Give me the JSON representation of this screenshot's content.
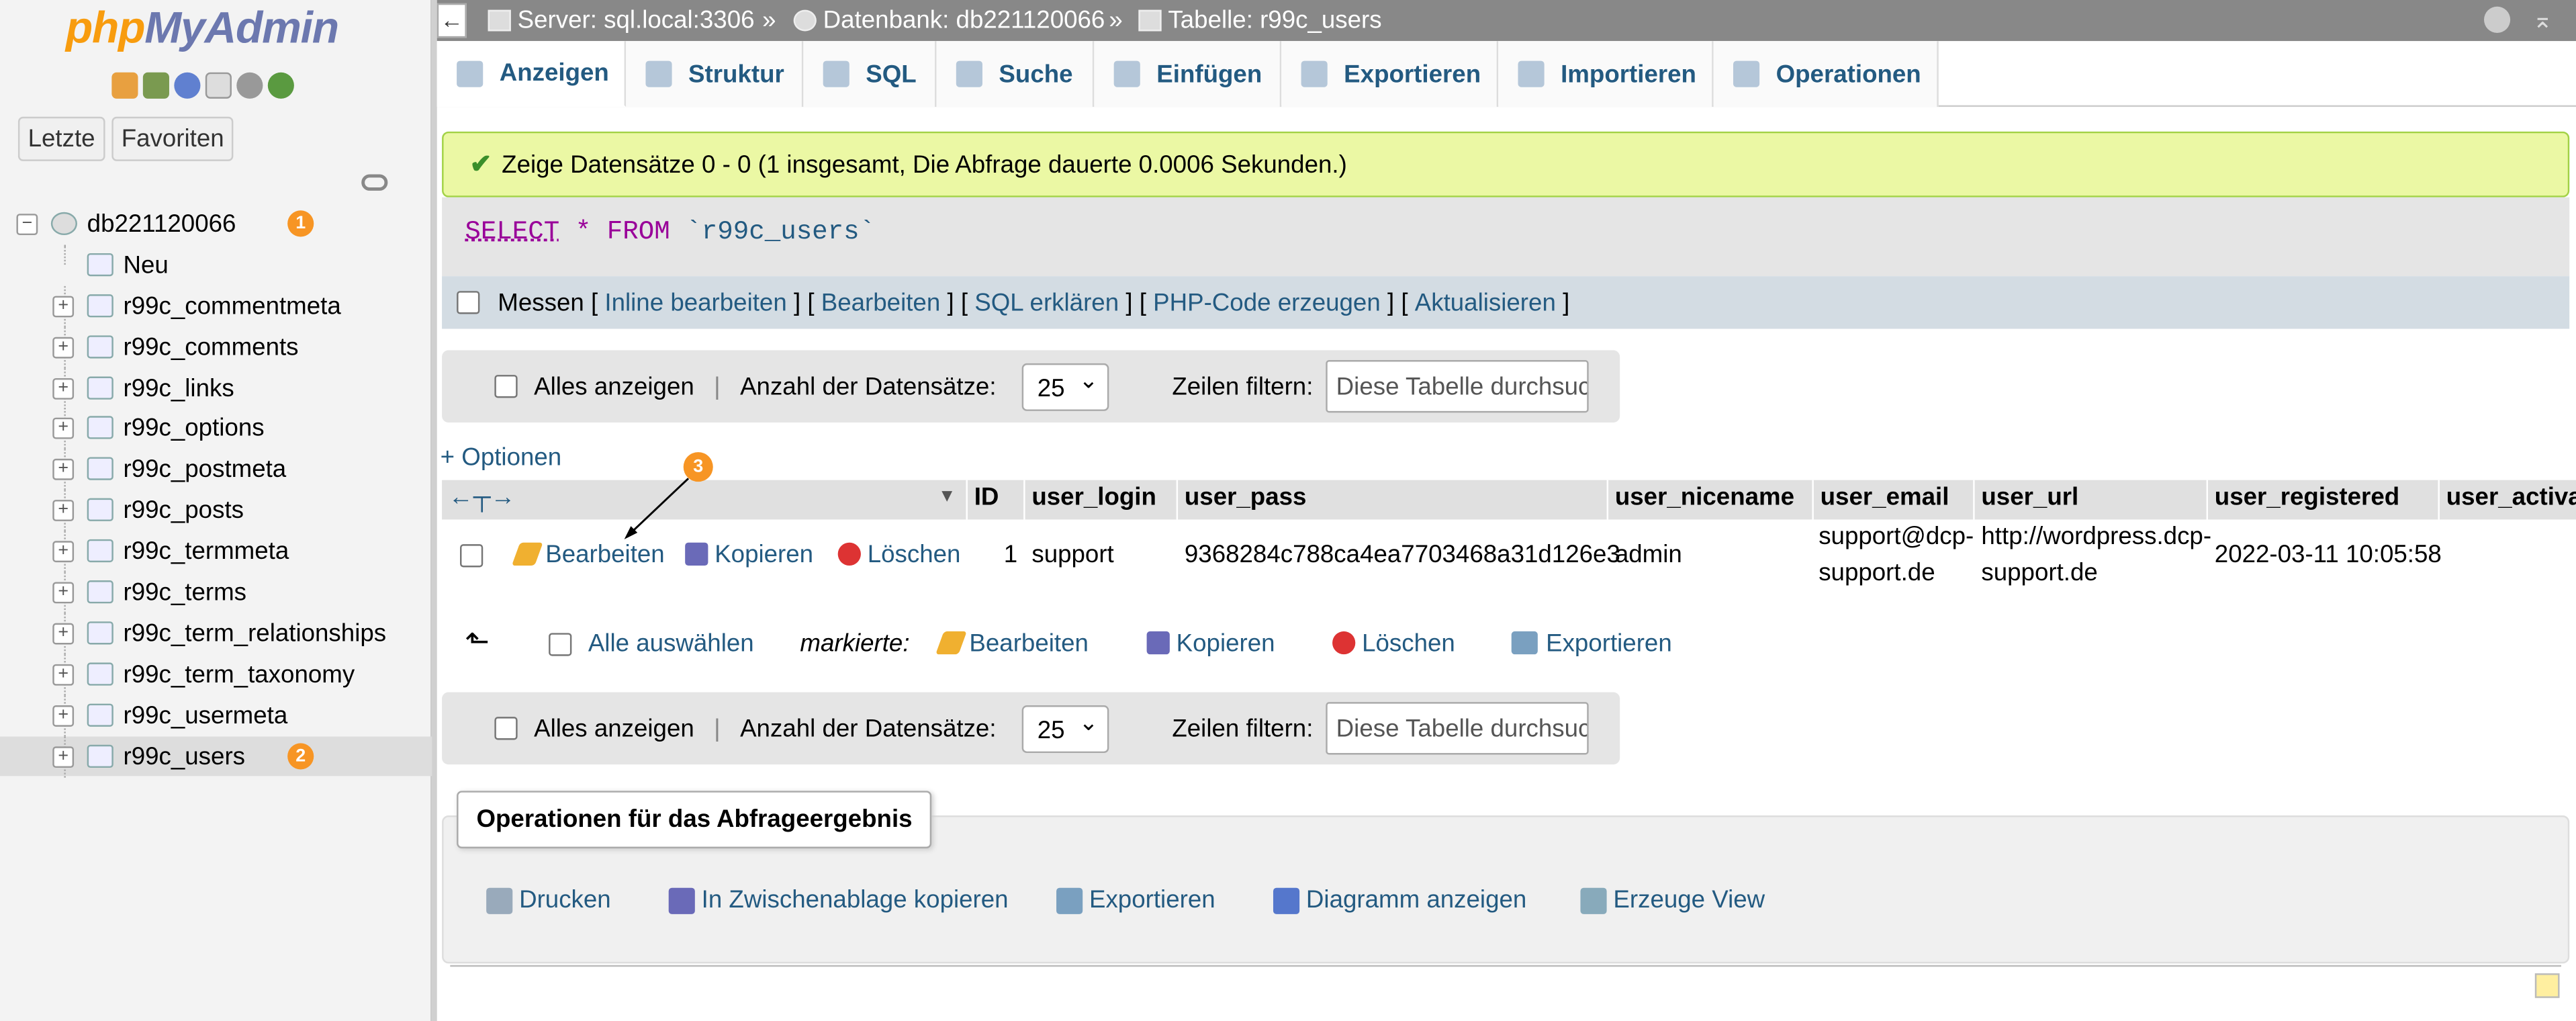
{
  "logo": {
    "a": "php",
    "b": "MyAdmin"
  },
  "sidebar": {
    "recent": "Letzte",
    "favorites": "Favoriten",
    "db": "db221120066",
    "new_label": "Neu",
    "tables": [
      "r99c_commentmeta",
      "r99c_comments",
      "r99c_links",
      "r99c_options",
      "r99c_postmeta",
      "r99c_posts",
      "r99c_termmeta",
      "r99c_terms",
      "r99c_term_relationships",
      "r99c_term_taxonomy",
      "r99c_usermeta",
      "r99c_users"
    ],
    "badge1": "1",
    "badge2": "2"
  },
  "breadcrumb": {
    "server": "Server: sql.local:3306",
    "database": "Datenbank: db221120066",
    "table": "Tabelle: r99c_users",
    "sep": "»"
  },
  "tabs": [
    "Anzeigen",
    "Struktur",
    "SQL",
    "Suche",
    "Einfügen",
    "Exportieren",
    "Importieren",
    "Operationen"
  ],
  "message": "Zeige Datensätze 0 - 0 (1 insgesamt, Die Abfrage dauerte 0.0006 Sekunden.)",
  "sql": {
    "select": "SELECT",
    "star": "*",
    "from": "FROM",
    "table": "`r99c_users`"
  },
  "sql_actions": {
    "profile": "Messen",
    "inline": "Inline bearbeiten",
    "edit": "Bearbeiten",
    "explain": "SQL erklären",
    "php": "PHP-Code erzeugen",
    "refresh": "Aktualisieren"
  },
  "nav": {
    "show_all": "Alles anzeigen",
    "rows_label": "Anzahl der Datensätze:",
    "rows": "25",
    "filter_label": "Zeilen filtern:",
    "filter_placeholder": "Diese Tabelle durchsuchen"
  },
  "options_link": "+ Optionen",
  "grid": {
    "headers": [
      "ID",
      "user_login",
      "user_pass",
      "user_nicename",
      "user_email",
      "user_url",
      "user_registered",
      "user_activa"
    ],
    "row": {
      "edit": "Bearbeiten",
      "copy": "Kopieren",
      "delete": "Löschen",
      "id": "1",
      "login": "support",
      "pass": "9368284c788ca4ea7703468a31d126e3",
      "nicename": "admin",
      "email1": "support@dcp-",
      "email2": "support.de",
      "url1": "http://wordpress.dcp-",
      "url2": "support.de",
      "registered": "2022-03-11 10:05:58"
    }
  },
  "bulk": {
    "select_all": "Alle auswählen",
    "with_selected": "markierte:",
    "edit": "Bearbeiten",
    "copy": "Kopieren",
    "delete": "Löschen",
    "export": "Exportieren"
  },
  "callout": "3",
  "ops": {
    "legend": "Operationen für das Abfrageergebnis",
    "print": "Drucken",
    "clipboard": "In Zwischenablage kopieren",
    "export": "Exportieren",
    "chart": "Diagramm anzeigen",
    "view": "Erzeuge View"
  }
}
